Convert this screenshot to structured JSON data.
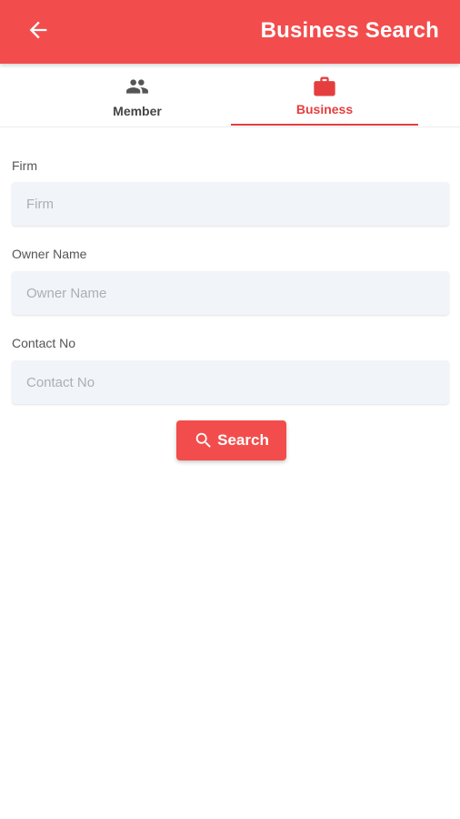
{
  "header": {
    "title": "Business Search",
    "back_icon": "arrow-left-icon",
    "background_color": "#f24d4c"
  },
  "tabs": [
    {
      "label": "Member",
      "icon": "people-icon",
      "selected": false
    },
    {
      "label": "Business",
      "icon": "briefcase-icon",
      "selected": true
    }
  ],
  "form": {
    "firm": {
      "label": "Firm",
      "placeholder": "Firm",
      "value": ""
    },
    "owner_name": {
      "label": "Owner Name",
      "placeholder": "Owner Name",
      "value": ""
    },
    "contact_no": {
      "label": "Contact No",
      "placeholder": "Contact No",
      "value": ""
    }
  },
  "search_button": {
    "label": "Search",
    "icon": "search-icon"
  },
  "colors": {
    "accent": "#f24d4c",
    "tab_active": "#e53e3e",
    "input_background": "#f1f4f8"
  }
}
